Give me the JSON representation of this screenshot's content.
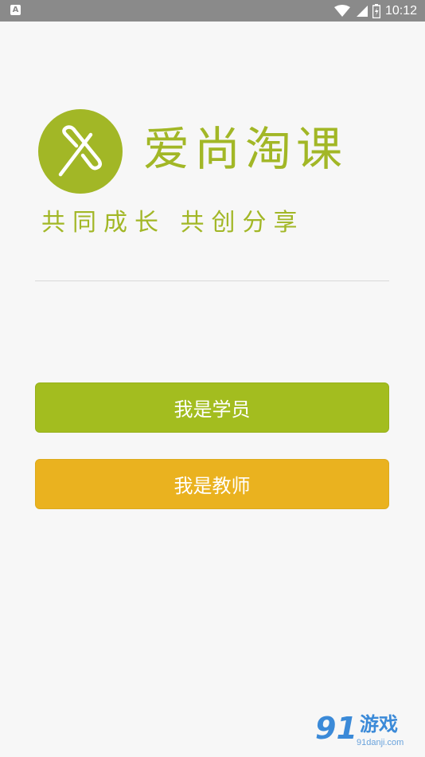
{
  "status_bar": {
    "app_icon_letter": "A",
    "time": "10:12",
    "icons": [
      "wifi-icon",
      "signal-icon",
      "battery-icon"
    ]
  },
  "logo": {
    "name": "爱尚淘课",
    "tagline": "共同成长  共创分享",
    "brand_color": "#a2b726"
  },
  "buttons": {
    "student": "我是学员",
    "teacher": "我是教师",
    "student_color": "#a3bd1f",
    "teacher_color": "#eab21f"
  },
  "watermark": {
    "number": "91",
    "title": "游戏",
    "url": "91danji.com"
  }
}
